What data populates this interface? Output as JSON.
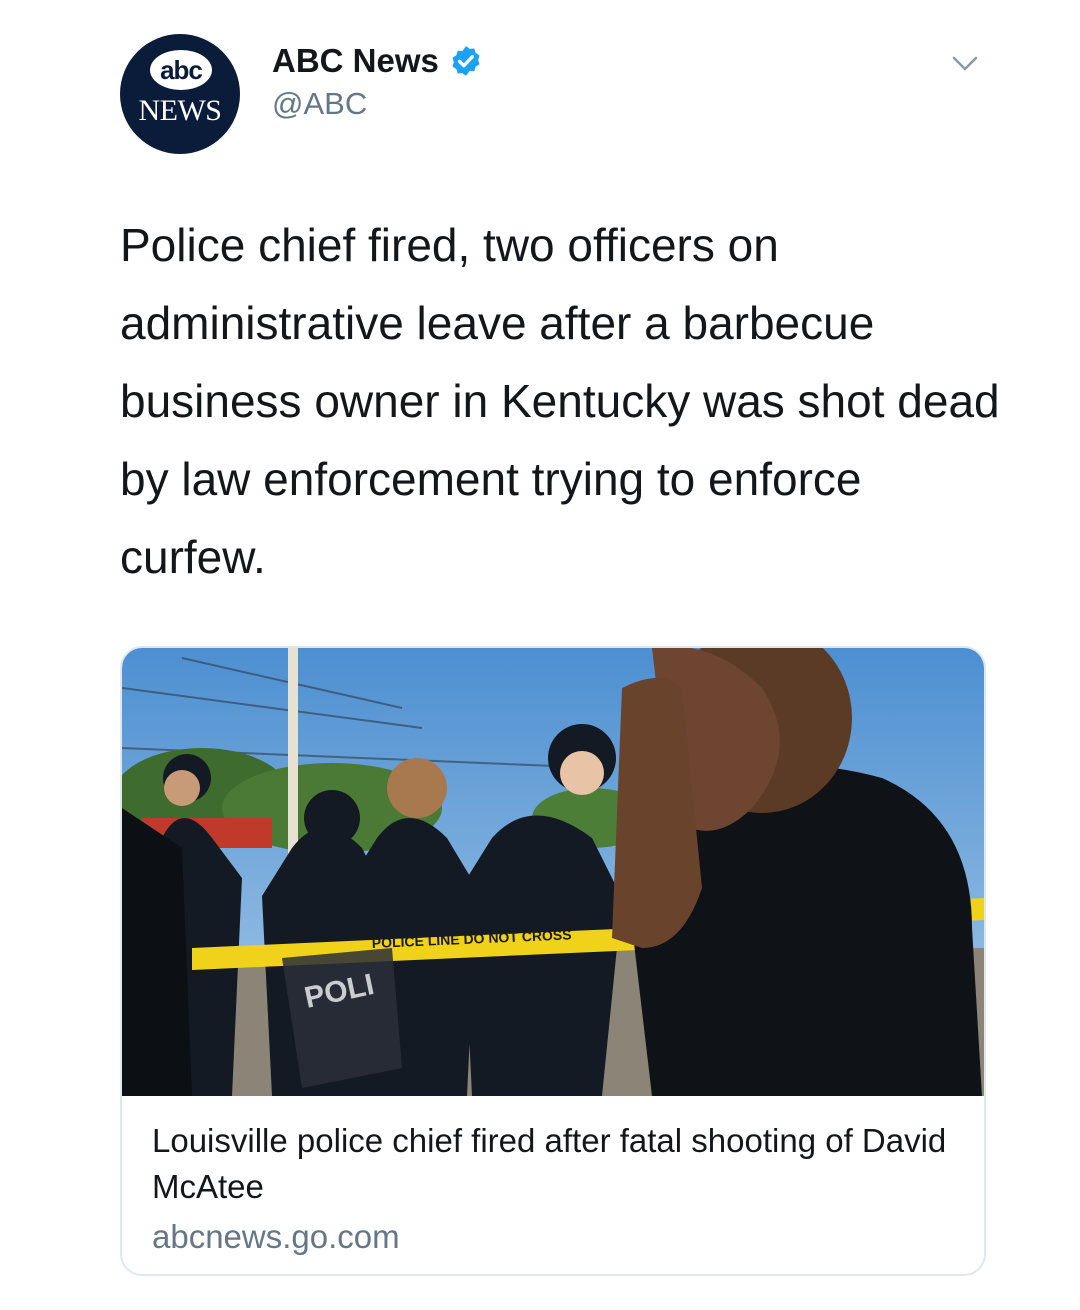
{
  "author": {
    "avatar_top": "abc",
    "avatar_bottom": "NEWS",
    "display_name": "ABC News",
    "handle": "@ABC",
    "verified": true
  },
  "tweet": {
    "text": "Police chief fired, two officers on administrative leave after a barbecue business owner in Kentucky was shot dead by law enforcement trying to enforce curfew."
  },
  "card": {
    "title": "Louisville police chief fired after fatal shooting of David McAtee",
    "domain": "abcnews.go.com",
    "image_description_icon": "news-photo",
    "tape_text": "POLICE LINE DO NOT CROSS",
    "shield_text": "POLI"
  },
  "colors": {
    "text": "#14171a",
    "secondary": "#657786",
    "verified": "#1da1f2",
    "border": "#e1e8ed",
    "abc_navy": "#0b1b3a"
  }
}
